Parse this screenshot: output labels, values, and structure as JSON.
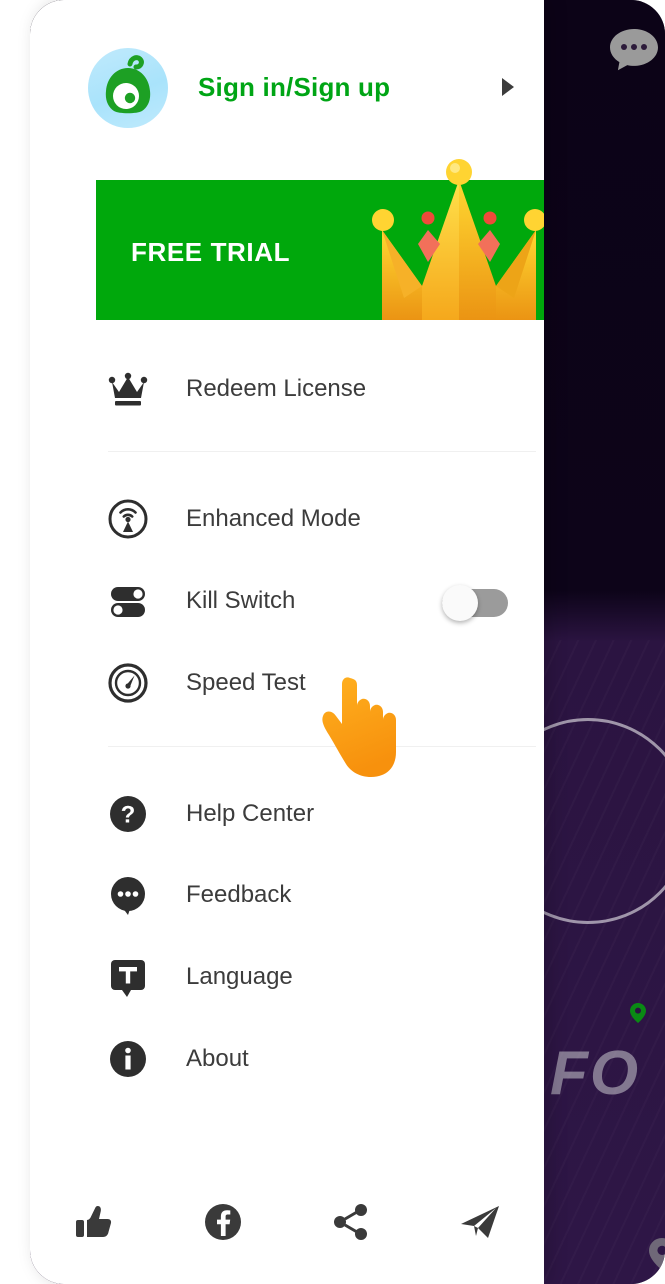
{
  "app": {
    "drawer_title": "Navigation drawer"
  },
  "account": {
    "label": "Sign in/Sign up",
    "logo_icon": "alien-mascot-logo",
    "chevron_icon": "chevron-right-icon"
  },
  "banner": {
    "label": "FREE TRIAL",
    "art_icon": "crown-illustration",
    "color": "#00a80c",
    "text_color": "#ffffff"
  },
  "menu": {
    "group_1": [
      {
        "label": "Redeem License",
        "icon": "crown-icon",
        "name": "redeem-license"
      }
    ],
    "group_2": [
      {
        "label": "Enhanced Mode",
        "icon": "broadcast-tower-icon",
        "name": "enhanced-mode"
      },
      {
        "label": "Kill Switch",
        "icon": "toggles-icon",
        "name": "kill-switch",
        "toggle": "off"
      },
      {
        "label": "Speed Test",
        "icon": "speedometer-icon",
        "name": "speed-test"
      }
    ],
    "group_3": [
      {
        "label": "Help Center",
        "icon": "question-circle-icon",
        "name": "help-center"
      },
      {
        "label": "Feedback",
        "icon": "chat-bubble-dots-icon",
        "name": "feedback"
      },
      {
        "label": "Language",
        "icon": "translate-bubble-icon",
        "name": "language"
      },
      {
        "label": "About",
        "icon": "info-circle-icon",
        "name": "about"
      }
    ]
  },
  "social": [
    {
      "icon": "thumbs-up-icon",
      "name": "rate-us"
    },
    {
      "icon": "facebook-icon",
      "name": "facebook"
    },
    {
      "icon": "share-icon",
      "name": "share"
    },
    {
      "icon": "telegram-icon",
      "name": "telegram"
    }
  ],
  "cursor": {
    "icon": "pointing-hand-cursor",
    "color": "#f79a16"
  },
  "background": {
    "chat_icon": "chat-bubble-icon",
    "fo_text": "FO",
    "green_pin_icon": "map-pin-icon",
    "gray_pin_icon": "location-pin-icon",
    "top_color": "#0d0418",
    "bottom_color": "#2e1646"
  },
  "colors": {
    "brand_green": "#00a515",
    "banner_green": "#00a80c",
    "text_dark": "#3c3c3c",
    "toggle_off": "#9b9b9b"
  }
}
